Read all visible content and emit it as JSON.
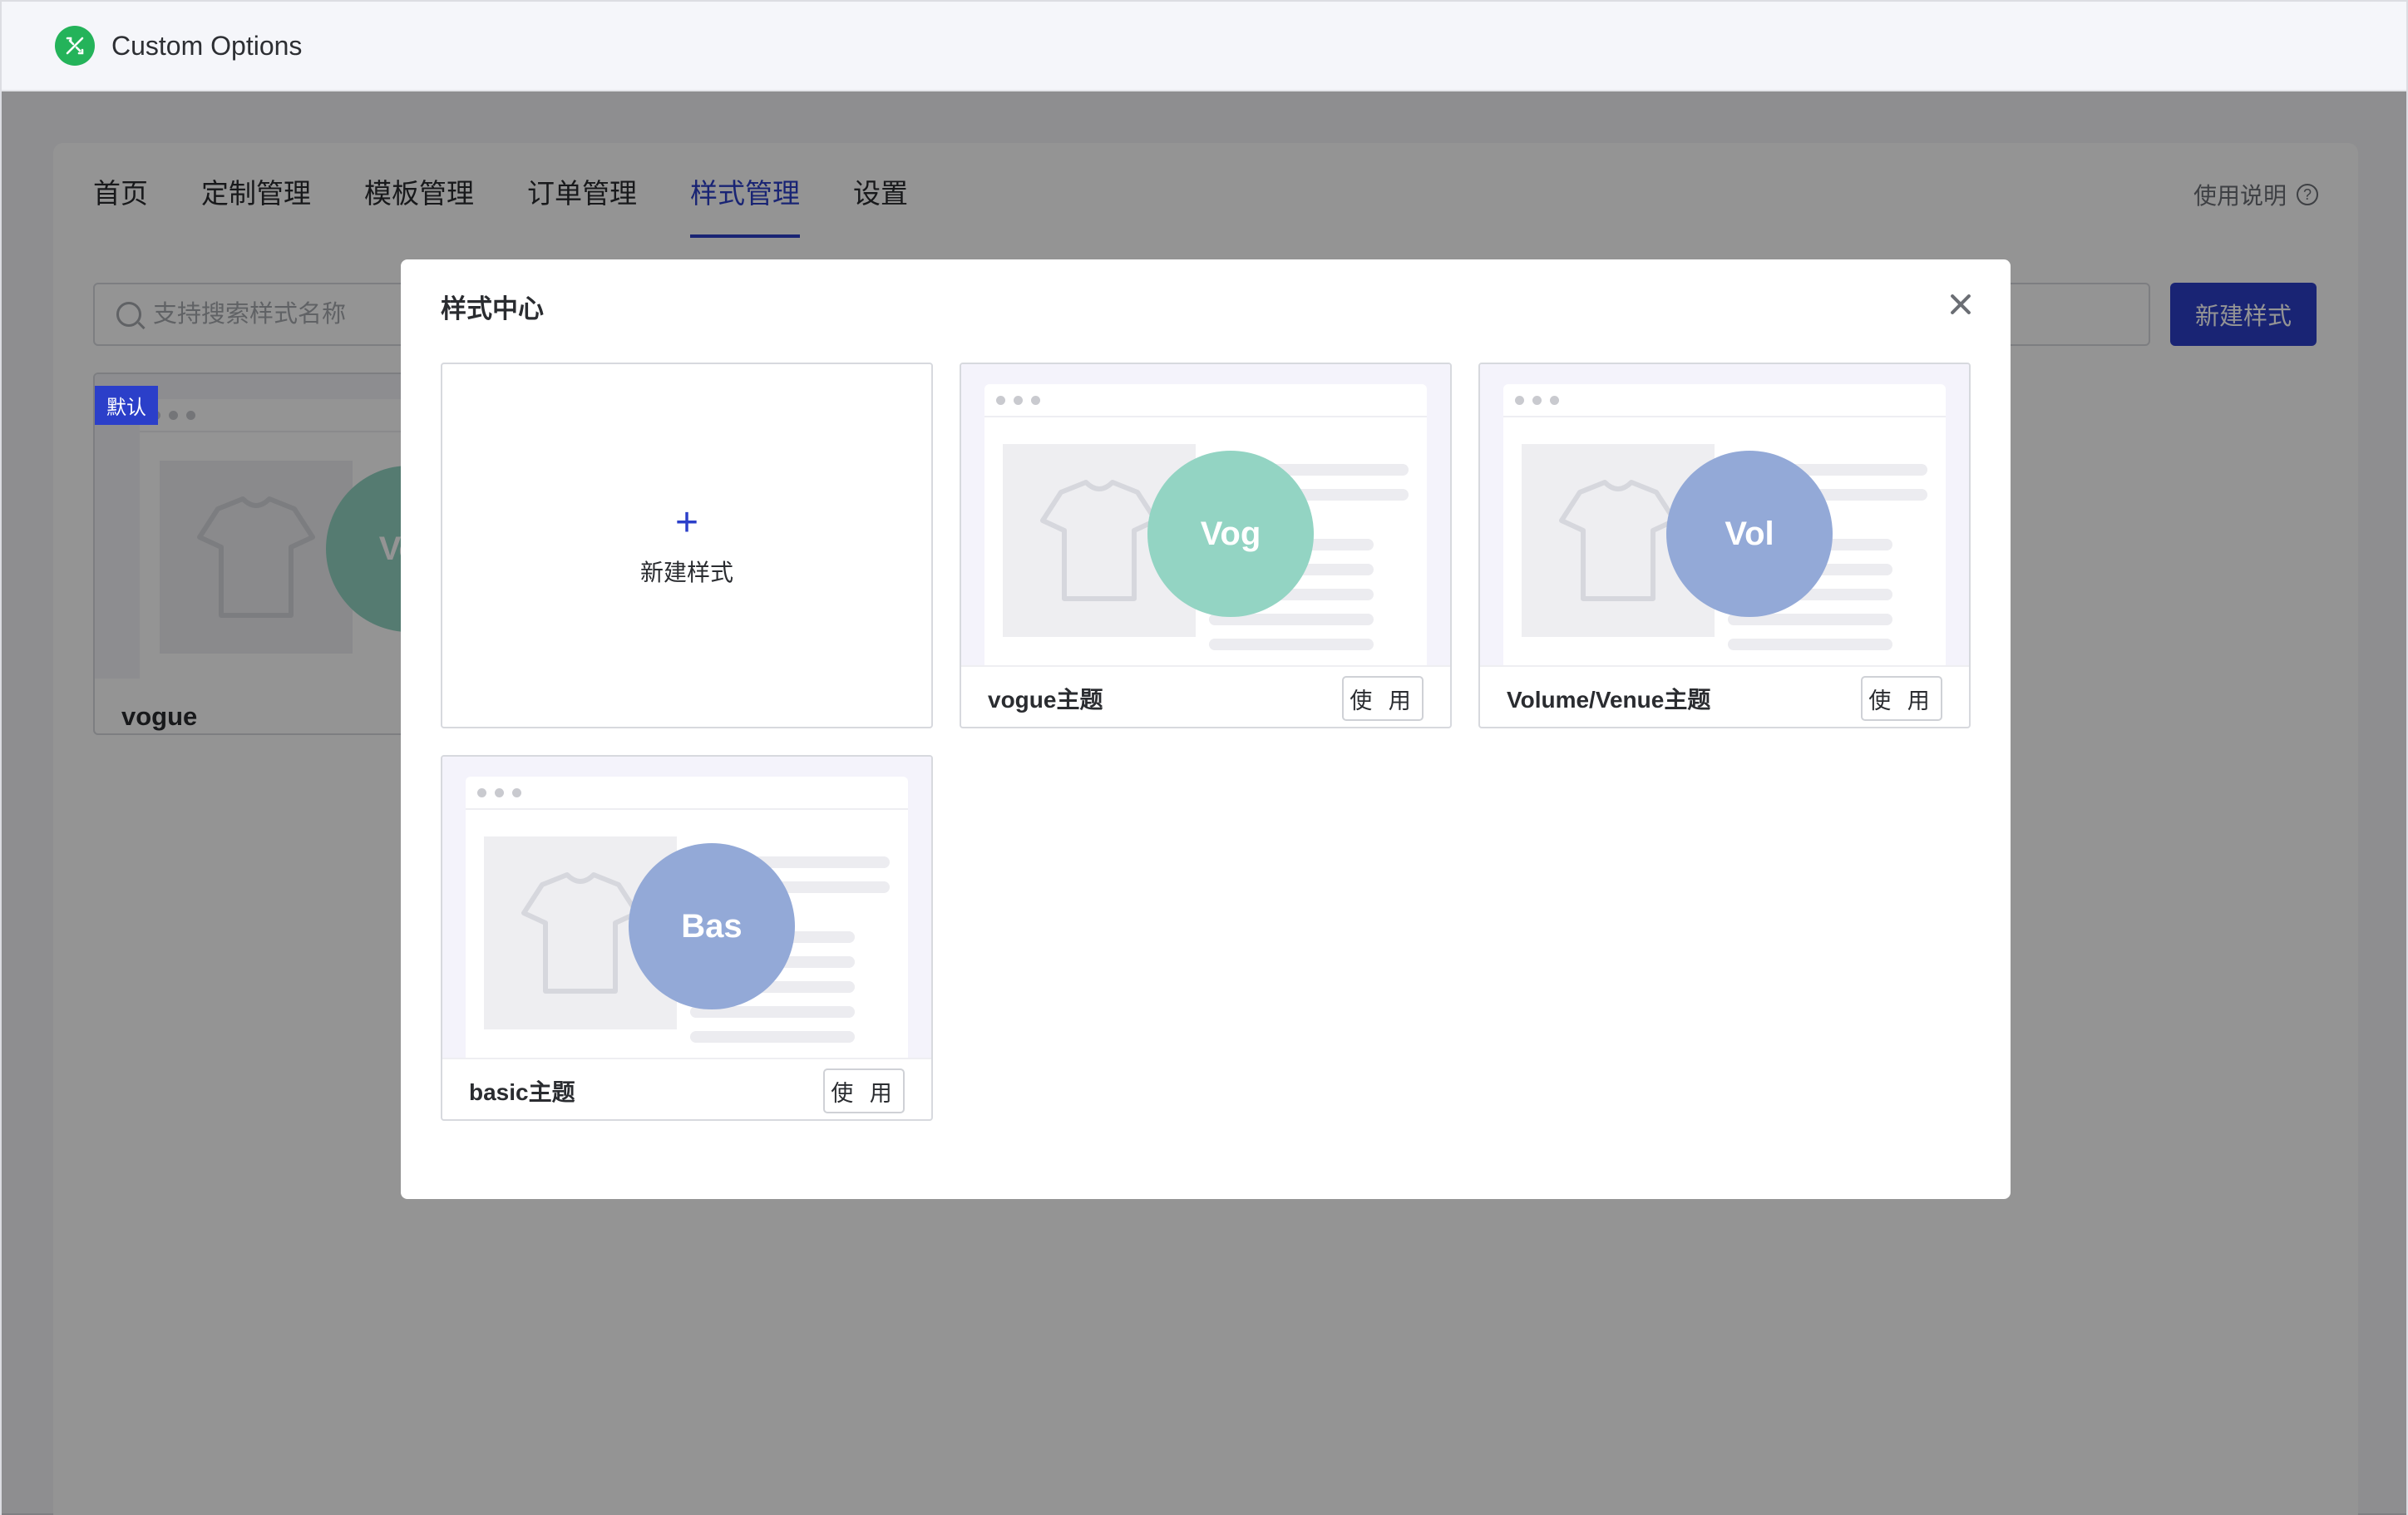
{
  "app": {
    "title": "Custom Options",
    "logo_icon": "puzzle-tools-icon",
    "logo_color": "#24b35a"
  },
  "nav": {
    "items": [
      {
        "label": "首页"
      },
      {
        "label": "定制管理"
      },
      {
        "label": "模板管理"
      },
      {
        "label": "订单管理"
      },
      {
        "label": "样式管理",
        "active": true
      },
      {
        "label": "设置"
      }
    ],
    "help_label": "使用说明"
  },
  "toolbar": {
    "search_placeholder": "支持搜索样式名称",
    "new_button_label": "新建样式",
    "accent_color": "#2b3fc9"
  },
  "existing_style": {
    "badge": "默认",
    "name": "vogue",
    "avatar_text": "Vog"
  },
  "modal": {
    "title": "样式中心",
    "new_tile_label": "新建样式",
    "use_label": "使 用",
    "templates": [
      {
        "name": "vogue主题",
        "avatar_text": "Vog",
        "avatar_color": "#93d4c3"
      },
      {
        "name": "Volume/Venue主题",
        "avatar_text": "Vol",
        "avatar_color": "#93a9d7"
      },
      {
        "name": "basic主题",
        "avatar_text": "Bas",
        "avatar_color": "#93a9d7"
      }
    ]
  }
}
